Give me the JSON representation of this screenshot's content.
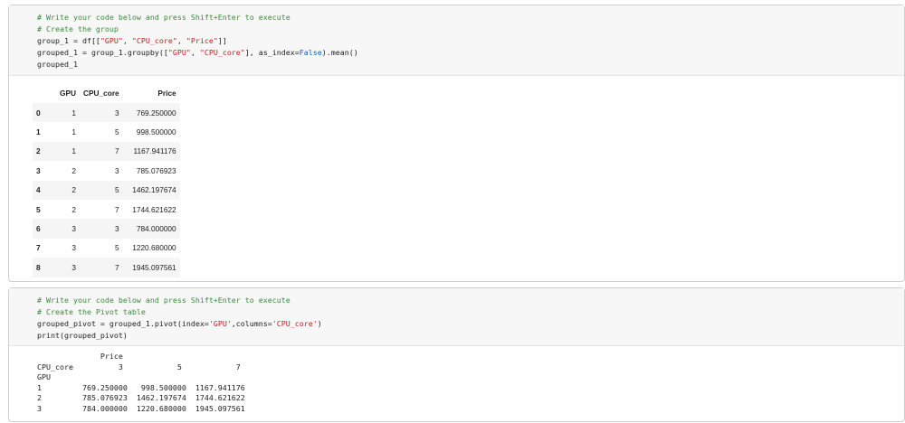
{
  "cell1": {
    "code": {
      "comment1": "# Write your code below and press Shift+Enter to execute",
      "comment2": "# Create the group",
      "line3_a": "group_1 = df[[",
      "line3_s1": "\"GPU\"",
      "line3_c1": ", ",
      "line3_s2": "\"CPU_core\"",
      "line3_c2": ", ",
      "line3_s3": "\"Price\"",
      "line3_b": "]]",
      "line4_a": "grouped_1 = group_1.groupby([",
      "line4_s1": "\"GPU\"",
      "line4_c1": ", ",
      "line4_s2": "\"CPU_core\"",
      "line4_b": "], as_index=",
      "line4_kw": "False",
      "line4_c": ").mean()",
      "line5": "grouped_1"
    },
    "table": {
      "columns": [
        "GPU",
        "CPU_core",
        "Price"
      ],
      "rows": [
        {
          "index": "0",
          "gpu": "1",
          "cpu": "3",
          "price": "769.250000"
        },
        {
          "index": "1",
          "gpu": "1",
          "cpu": "5",
          "price": "998.500000"
        },
        {
          "index": "2",
          "gpu": "1",
          "cpu": "7",
          "price": "1167.941176"
        },
        {
          "index": "3",
          "gpu": "2",
          "cpu": "3",
          "price": "785.076923"
        },
        {
          "index": "4",
          "gpu": "2",
          "cpu": "5",
          "price": "1462.197674"
        },
        {
          "index": "5",
          "gpu": "2",
          "cpu": "7",
          "price": "1744.621622"
        },
        {
          "index": "6",
          "gpu": "3",
          "cpu": "3",
          "price": "784.000000"
        },
        {
          "index": "7",
          "gpu": "3",
          "cpu": "5",
          "price": "1220.680000"
        },
        {
          "index": "8",
          "gpu": "3",
          "cpu": "7",
          "price": "1945.097561"
        }
      ]
    }
  },
  "cell2": {
    "code": {
      "comment1": "# Write your code below and press Shift+Enter to execute",
      "comment2": "# Create the Pivot table",
      "line3_a": "grouped_pivot = grouped_1.pivot(index=",
      "line3_s1": "'GPU'",
      "line3_b": ",columns=",
      "line3_s2": "'CPU_core'",
      "line3_c": ")",
      "line4": "print(grouped_pivot)"
    },
    "output": [
      "              Price                        ",
      "CPU_core          3            5            7",
      "GPU                                          ",
      "1         769.250000   998.500000  1167.941176",
      "2         785.076923  1462.197674  1744.621622",
      "3         784.000000  1220.680000  1945.097561"
    ]
  }
}
